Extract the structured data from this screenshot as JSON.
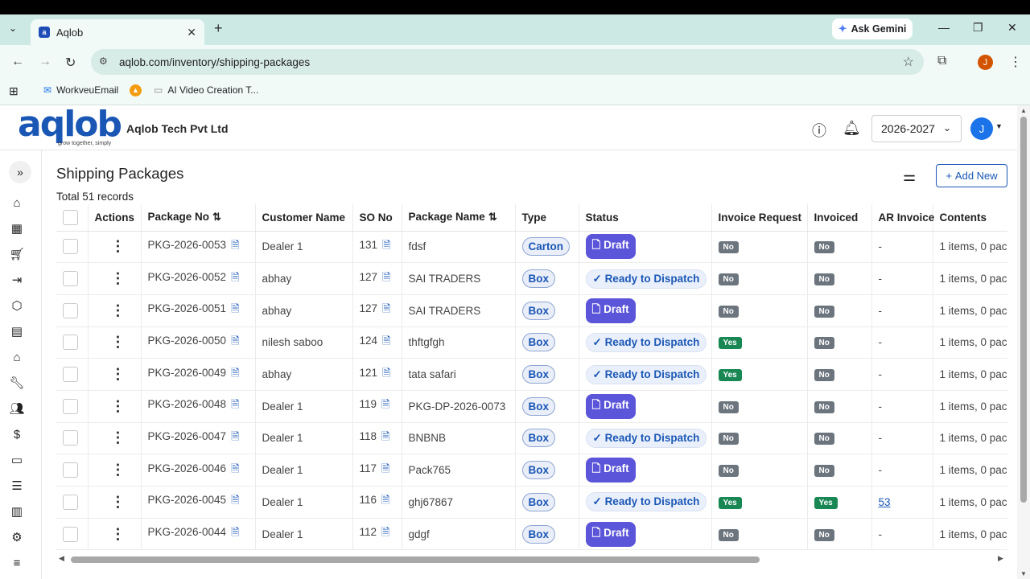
{
  "browser": {
    "tab_title": "Aqlob",
    "tab_favicon": "a",
    "ask_gemini": "Ask Gemini",
    "url": "aqlob.com/inventory/shipping-packages",
    "profile_initial": "J",
    "bookmarks": [
      {
        "label": "WorkveuEmail",
        "icon": "mail-icon"
      },
      {
        "label": "",
        "icon": "bookmark-logo-icon"
      },
      {
        "label": "AI Video Creation T...",
        "icon": "link-icon"
      }
    ]
  },
  "app": {
    "logo_text": "aqlob",
    "logo_tagline": "grow together, simply",
    "company": "Aqlob Tech Pvt Ltd",
    "year": "2026-2027",
    "avatar": "J"
  },
  "page": {
    "title": "Shipping Packages",
    "total": "Total 51 records",
    "add_new": "Add New"
  },
  "table": {
    "columns": [
      "Actions",
      "Package No",
      "Customer Name",
      "SO No",
      "Package Name",
      "Type",
      "Status",
      "Invoice Request",
      "Invoiced",
      "AR Invoice",
      "Contents"
    ],
    "rows": [
      {
        "pkg": "PKG-2026-0053",
        "customer": "Dealer 1",
        "so": "131",
        "name": "fdsf",
        "type": "Carton",
        "status": "Draft",
        "invreq": "No",
        "invoiced": "No",
        "ar": "-",
        "contents": "1 items, 0 pac"
      },
      {
        "pkg": "PKG-2026-0052",
        "customer": "abhay",
        "so": "127",
        "name": "SAI TRADERS",
        "type": "Box",
        "status": "Ready to Dispatch",
        "invreq": "No",
        "invoiced": "No",
        "ar": "-",
        "contents": "1 items, 0 pac"
      },
      {
        "pkg": "PKG-2026-0051",
        "customer": "abhay",
        "so": "127",
        "name": "SAI TRADERS",
        "type": "Box",
        "status": "Draft",
        "invreq": "No",
        "invoiced": "No",
        "ar": "-",
        "contents": "1 items, 0 pac"
      },
      {
        "pkg": "PKG-2026-0050",
        "customer": "nilesh saboo",
        "so": "124",
        "name": "thftgfgh",
        "type": "Box",
        "status": "Ready to Dispatch",
        "invreq": "Yes",
        "invoiced": "No",
        "ar": "-",
        "contents": "1 items, 0 pac"
      },
      {
        "pkg": "PKG-2026-0049",
        "customer": "abhay",
        "so": "121",
        "name": "tata safari",
        "type": "Box",
        "status": "Ready to Dispatch",
        "invreq": "Yes",
        "invoiced": "No",
        "ar": "-",
        "contents": "1 items, 0 pac"
      },
      {
        "pkg": "PKG-2026-0048",
        "customer": "Dealer 1",
        "so": "119",
        "name": "PKG-DP-2026-0073",
        "type": "Box",
        "status": "Draft",
        "invreq": "No",
        "invoiced": "No",
        "ar": "-",
        "contents": "1 items, 0 pac"
      },
      {
        "pkg": "PKG-2026-0047",
        "customer": "Dealer 1",
        "so": "118",
        "name": "BNBNB",
        "type": "Box",
        "status": "Ready to Dispatch",
        "invreq": "No",
        "invoiced": "No",
        "ar": "-",
        "contents": "1 items, 0 pac"
      },
      {
        "pkg": "PKG-2026-0046",
        "customer": "Dealer 1",
        "so": "117",
        "name": "Pack765",
        "type": "Box",
        "status": "Draft",
        "invreq": "No",
        "invoiced": "No",
        "ar": "-",
        "contents": "1 items, 0 pac"
      },
      {
        "pkg": "PKG-2026-0045",
        "customer": "Dealer 1",
        "so": "116",
        "name": "ghj67867",
        "type": "Box",
        "status": "Ready to Dispatch",
        "invreq": "Yes",
        "invoiced": "Yes",
        "ar": "53",
        "contents": "1 items, 0 pac"
      },
      {
        "pkg": "PKG-2026-0044",
        "customer": "Dealer 1",
        "so": "112",
        "name": "gdgf",
        "type": "Box",
        "status": "Draft",
        "invreq": "No",
        "invoiced": "No",
        "ar": "-",
        "contents": "1 items, 0 pac"
      }
    ]
  },
  "sidebar_icons": [
    "home-icon",
    "calendar-icon",
    "cart-icon",
    "login-icon",
    "box-icon",
    "building-icon",
    "bank-icon",
    "wrench-icon",
    "users-icon",
    "dollar-icon",
    "wallet-icon",
    "list-icon",
    "chart-icon",
    "settings-icon",
    "menu-icon"
  ],
  "colors": {
    "brand": "#1a57b5",
    "draft": "#5b55d9",
    "yes": "#198754",
    "no": "#6c757d"
  }
}
